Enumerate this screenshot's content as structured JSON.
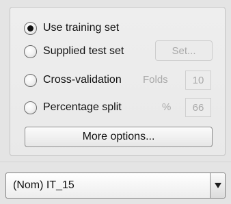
{
  "test_options": {
    "use_training_set": {
      "label": "Use training set",
      "selected": true
    },
    "supplied_test_set": {
      "label": "Supplied test set",
      "selected": false,
      "set_button_label": "Set..."
    },
    "cross_validation": {
      "label": "Cross-validation",
      "selected": false,
      "folds_label": "Folds",
      "folds_value": "10"
    },
    "percentage_split": {
      "label": "Percentage split",
      "selected": false,
      "percent_label": "%",
      "percent_value": "66"
    },
    "more_options_label": "More options..."
  },
  "class_selector": {
    "value": "(Nom) IT_15"
  }
}
